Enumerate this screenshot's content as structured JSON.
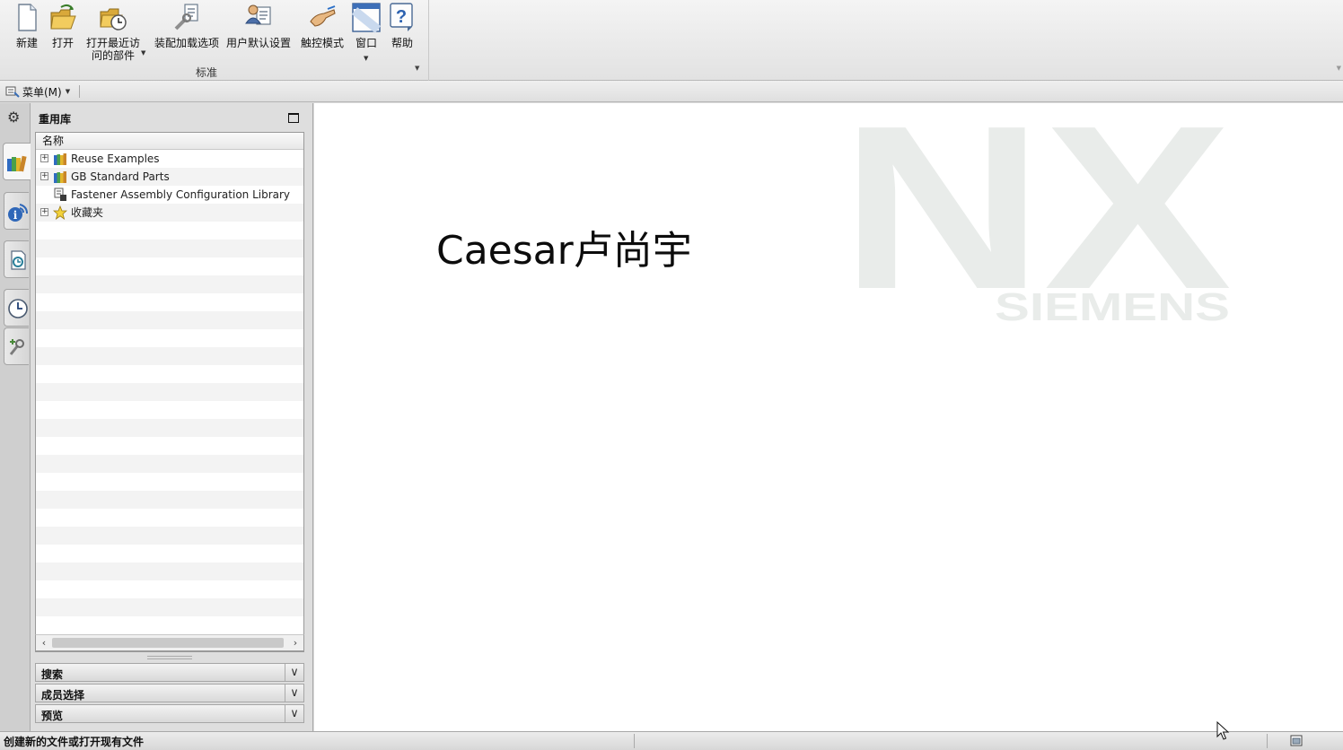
{
  "ribbon": {
    "buttons": [
      {
        "label": "新建",
        "icon": "new-file-icon"
      },
      {
        "label": "打开",
        "icon": "open-folder-icon"
      },
      {
        "label": "打开最近访",
        "label2": "问的部件",
        "icon": "recent-parts-icon",
        "dropdown": true
      },
      {
        "label": "装配加载选项",
        "icon": "assembly-load-options-icon"
      },
      {
        "label": "用户默认设置",
        "icon": "user-defaults-icon"
      },
      {
        "label": "触控模式",
        "icon": "touch-mode-icon"
      },
      {
        "label": "窗口",
        "icon": "window-icon",
        "dropdown": true
      },
      {
        "label": "帮助",
        "icon": "help-icon"
      }
    ],
    "group_label": "标准"
  },
  "menubar": {
    "menu_label": "菜单(M)"
  },
  "resource_bar": {
    "tabs": [
      "reuse-library-icon",
      "info-feed-icon",
      "history-document-icon",
      "clock-history-icon",
      "process-studio-icon"
    ]
  },
  "navigator": {
    "title": "重用库",
    "column_header": "名称",
    "items": [
      {
        "label": "Reuse Examples",
        "expandable": true,
        "icon": "book-stack-icon"
      },
      {
        "label": "GB Standard Parts",
        "expandable": true,
        "icon": "book-stack-icon"
      },
      {
        "label": "Fastener Assembly Configuration Library",
        "expandable": false,
        "icon": "fastener-library-icon"
      },
      {
        "label": "收藏夹",
        "expandable": true,
        "icon": "favorites-star-icon"
      }
    ],
    "sections": [
      {
        "label": "搜索"
      },
      {
        "label": "成员选择"
      },
      {
        "label": "预览"
      }
    ]
  },
  "graphics": {
    "overlay_text": "Caesar卢尚宇",
    "logo_main": "NX",
    "logo_sub": "SIEMENS"
  },
  "status": {
    "message": "创建新的文件或打开现有文件"
  },
  "colors": {
    "logo": "#e9ecea",
    "panel": "#dedede",
    "ribbon": "#ececec"
  }
}
